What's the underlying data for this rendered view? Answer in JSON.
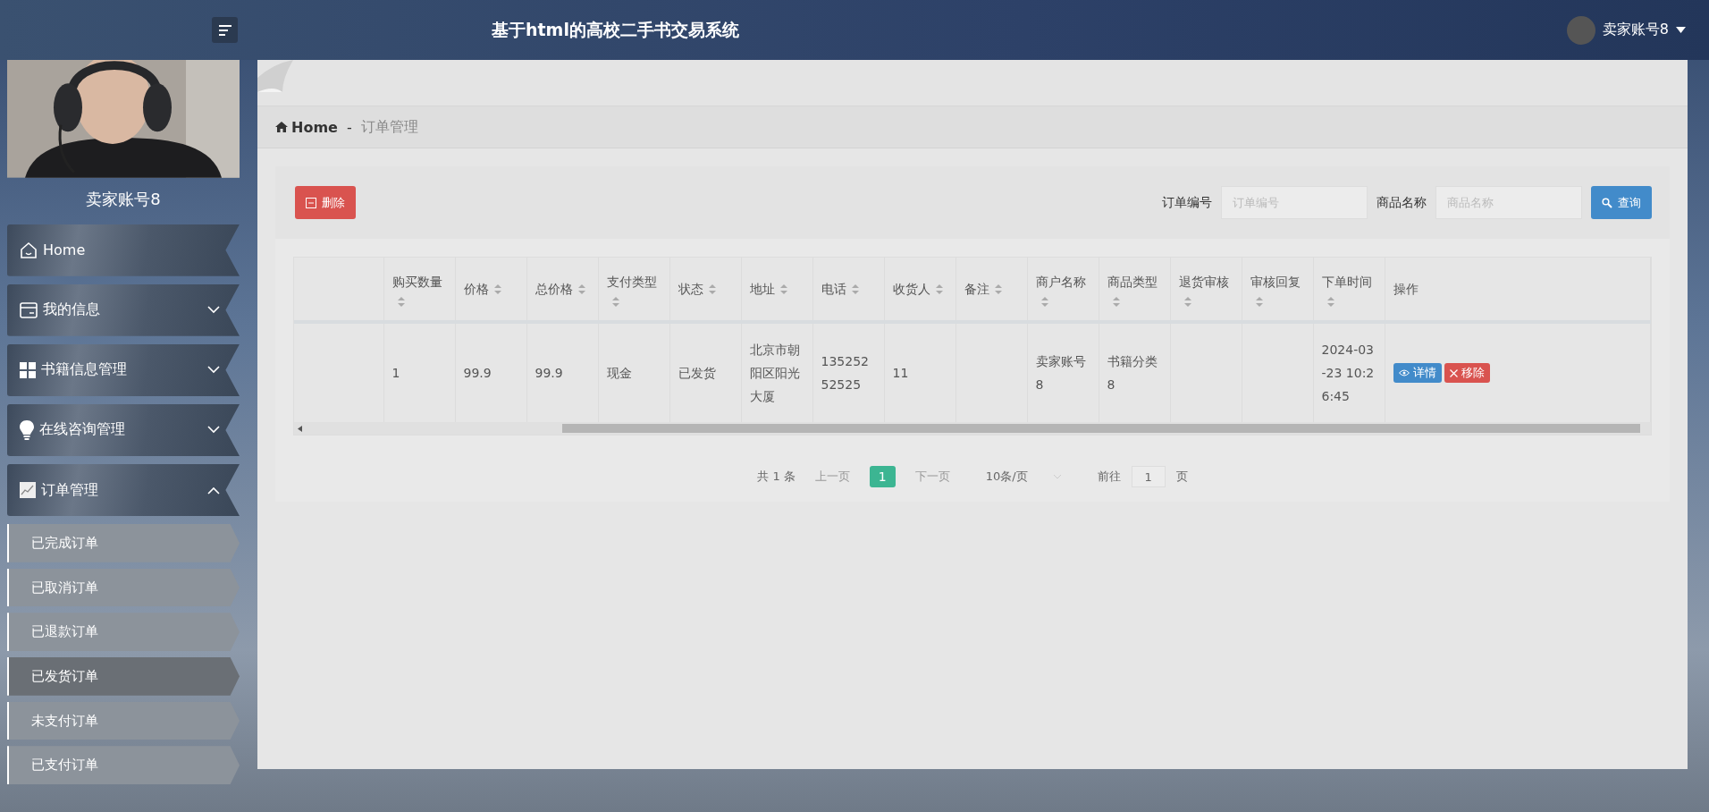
{
  "header": {
    "title": "基于html的高校二手书交易系统",
    "user": "卖家账号8"
  },
  "sidebar": {
    "user_name": "卖家账号8",
    "items": [
      {
        "label": "Home",
        "kind": "link"
      },
      {
        "label": "我的信息",
        "kind": "group",
        "expanded": false
      },
      {
        "label": "书籍信息管理",
        "kind": "group",
        "expanded": false
      },
      {
        "label": "在线咨询管理",
        "kind": "group",
        "expanded": false
      },
      {
        "label": "订单管理",
        "kind": "group",
        "expanded": true,
        "children": [
          {
            "label": "已完成订单",
            "selected": false
          },
          {
            "label": "已取消订单",
            "selected": false
          },
          {
            "label": "已退款订单",
            "selected": false
          },
          {
            "label": "已发货订单",
            "selected": true
          },
          {
            "label": "未支付订单",
            "selected": false
          },
          {
            "label": "已支付订单",
            "selected": false
          }
        ]
      }
    ]
  },
  "breadcrumb": {
    "home": "Home",
    "separator": "-",
    "current": "订单管理"
  },
  "toolbar": {
    "delete_button": "删除",
    "filters": [
      {
        "label": "订单编号",
        "placeholder": "订单编号"
      },
      {
        "label": "商品名称",
        "placeholder": "商品名称"
      }
    ],
    "search_button": "查询"
  },
  "table": {
    "columns": [
      {
        "label": "购买数量",
        "sortable": true
      },
      {
        "label": "价格",
        "sortable": true
      },
      {
        "label": "总价格",
        "sortable": true
      },
      {
        "label": "支付类型",
        "sortable": true
      },
      {
        "label": "状态",
        "sortable": true
      },
      {
        "label": "地址",
        "sortable": true
      },
      {
        "label": "电话",
        "sortable": true
      },
      {
        "label": "收货人",
        "sortable": true
      },
      {
        "label": "备注",
        "sortable": true
      },
      {
        "label": "商户名称",
        "sortable": true
      },
      {
        "label": "商品类型",
        "sortable": true
      },
      {
        "label": "退货审核",
        "sortable": true
      },
      {
        "label": "审核回复",
        "sortable": true
      },
      {
        "label": "下单时间",
        "sortable": true
      },
      {
        "label": "操作",
        "sortable": false
      }
    ],
    "rows": [
      {
        "cells": [
          "1",
          "99.9",
          "99.9",
          "现金",
          "已发货",
          "北京市朝阳区阳光大厦",
          "13525252525",
          "11",
          "",
          "卖家账号8",
          "书籍分类8",
          "",
          "",
          "2024-03-23 10:26:45"
        ],
        "actions": [
          {
            "label": "详情",
            "kind": "view"
          },
          {
            "label": "移除",
            "kind": "remove"
          }
        ]
      }
    ]
  },
  "pagination": {
    "total": "共 1 条",
    "prev": "上一页",
    "pages": [
      {
        "label": "1",
        "selected": true
      }
    ],
    "next": "下一页",
    "page_size": "10条/页",
    "goto_label": "前往",
    "goto_value": "1",
    "goto_suffix": "页"
  }
}
